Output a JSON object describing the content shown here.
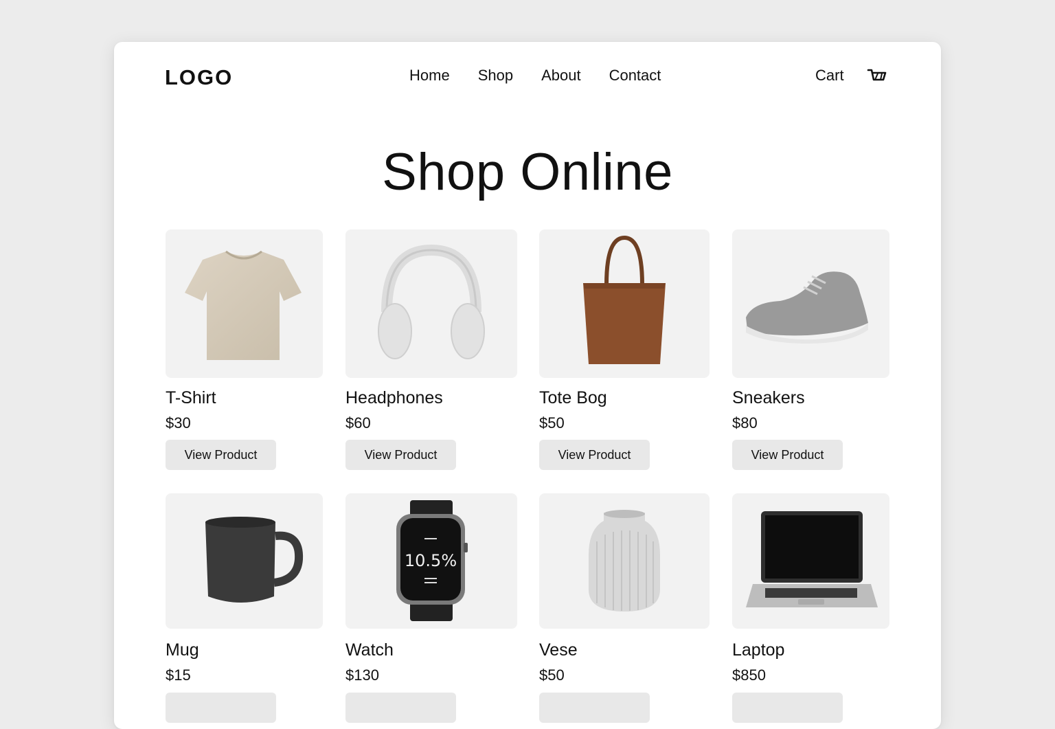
{
  "header": {
    "logo": "LOGO",
    "nav": [
      "Home",
      "Shop",
      "About",
      "Contact"
    ],
    "cart_label": "Cart"
  },
  "hero": {
    "title": "Shop Online"
  },
  "products": [
    {
      "name": "T-Shirt",
      "price": "$30",
      "button": "View Product",
      "icon": "tshirt-image"
    },
    {
      "name": "Headphones",
      "price": "$60",
      "button": "View Product",
      "icon": "headphones-image"
    },
    {
      "name": "Tote Bog",
      "price": "$50",
      "button": "View Product",
      "icon": "tote-bag-image"
    },
    {
      "name": "Sneakers",
      "price": "$80",
      "button": "View Product",
      "icon": "sneaker-image"
    },
    {
      "name": "Mug",
      "price": "$15",
      "button": "",
      "icon": "mug-image"
    },
    {
      "name": "Watch",
      "price": "$130",
      "button": "",
      "icon": "watch-image",
      "screen_text": "10.5%"
    },
    {
      "name": "Vese",
      "price": "$50",
      "button": "",
      "icon": "vase-image"
    },
    {
      "name": "Laptop",
      "price": "$850",
      "button": "",
      "icon": "laptop-image"
    }
  ],
  "colors": {
    "background": "#ececec",
    "card": "#ffffff",
    "thumb_bg": "#f2f2f2",
    "button_bg": "#e8e8e8",
    "text": "#111111"
  }
}
